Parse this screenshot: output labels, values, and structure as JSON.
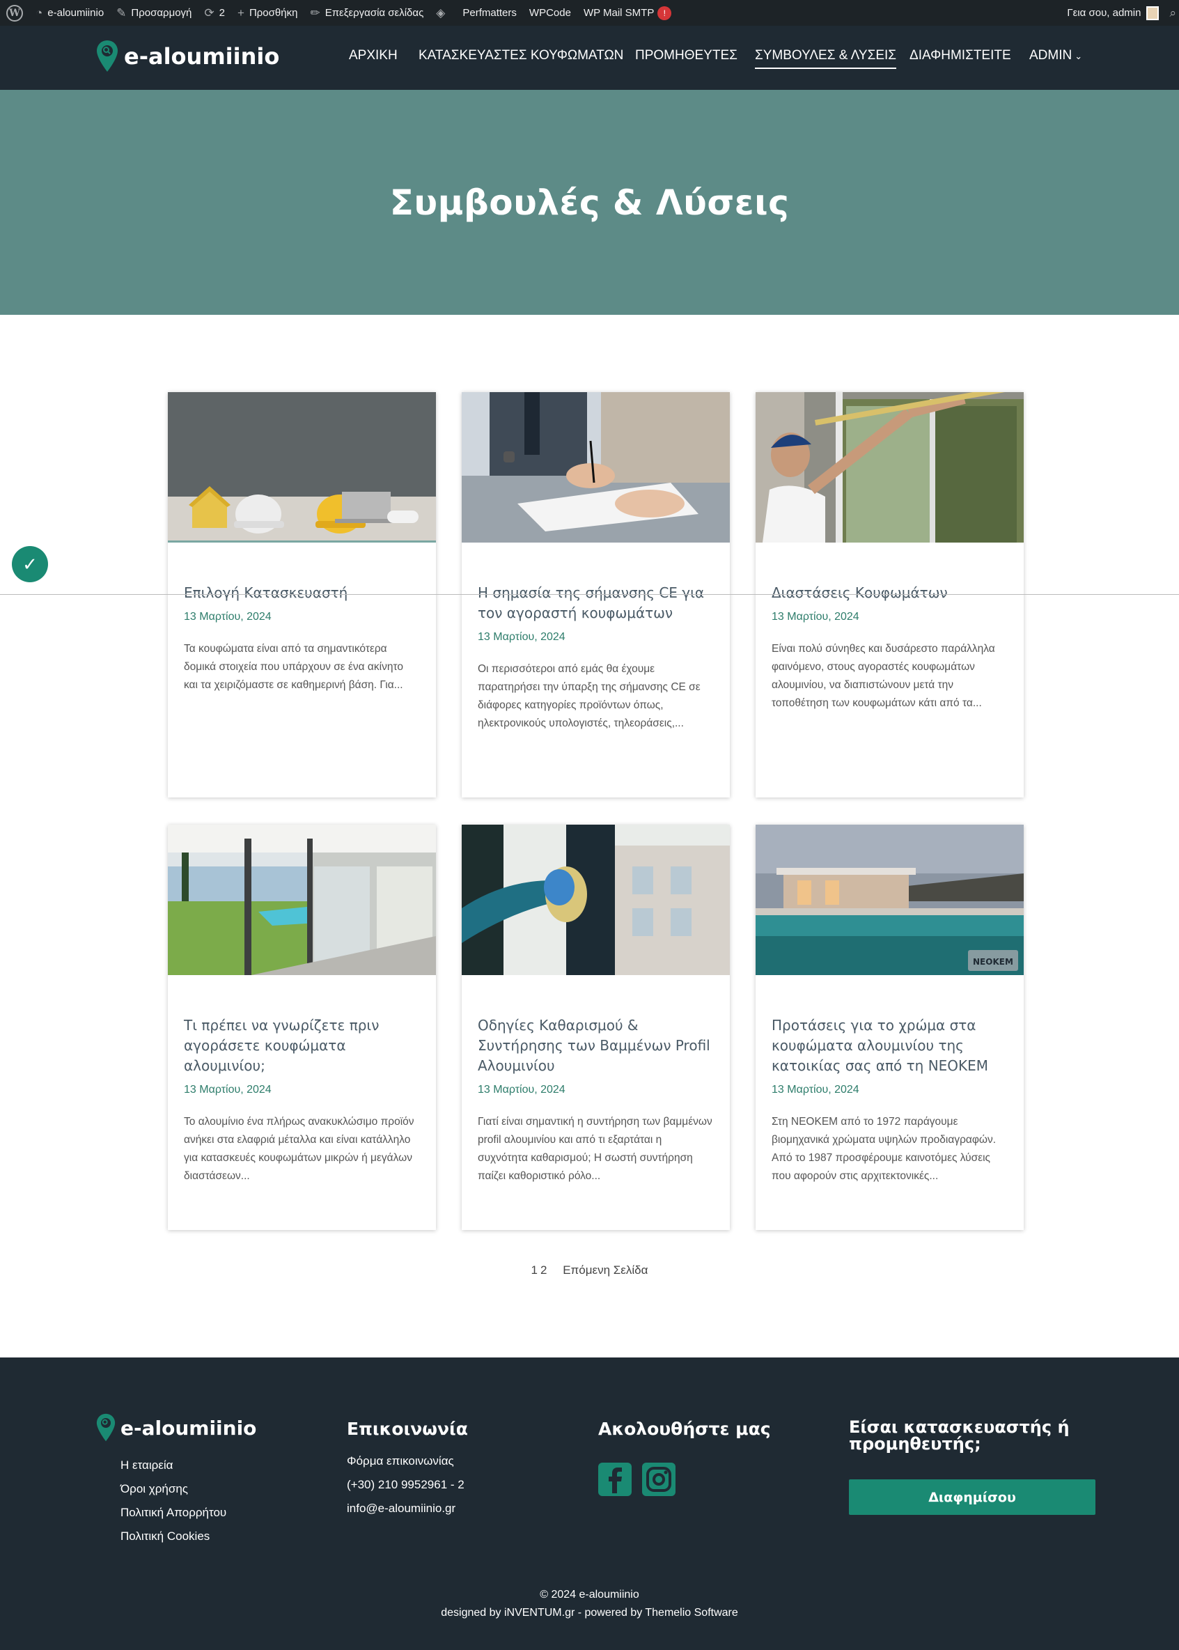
{
  "admin_bar": {
    "site": "e-aloumiinio",
    "customize": "Προσαρμογή",
    "updates": "2",
    "new": "Προσθήκη",
    "edit": "Επεξεργασία σελίδας",
    "perfmatters": "Perfmatters",
    "wpcode": "WPCode",
    "smtp": "WP Mail SMTP",
    "smtp_badge": "!",
    "greeting": "Γεια σου, admin"
  },
  "header": {
    "logo": "e-aloumiinio",
    "nav": [
      "ΑΡΧΙΚΗ",
      "ΚΑΤΑΣΚΕΥΑΣΤΕΣ ΚΟΥΦΩΜΑΤΩΝ",
      "ΠΡΟΜΗΘΕΥΤΕΣ",
      "ΣΥΜΒΟΥΛΕΣ & ΛΥΣΕΙΣ",
      "ΔΙΑΦΗΜΙΣΤΕΙΤΕ",
      "ADMIN"
    ]
  },
  "hero": {
    "title": "Συμβουλές & Λύσεις"
  },
  "posts": [
    {
      "title": "Επιλογή Κατασκευαστή",
      "date": "13 Μαρτίου, 2024",
      "excerpt": "Τα κουφώματα είναι από τα σημαντικότερα δομικά στοιχεία που υπάρχουν σε ένα ακίνητο και τα χειριζόμαστε σε καθημερινή βάση. Για..."
    },
    {
      "title": "Η σημασία της σήμανσης CE για τον αγοραστή κουφωμάτων",
      "date": "13 Μαρτίου, 2024",
      "excerpt": "Οι περισσότεροι από εμάς θα έχουμε παρατηρήσει την ύπαρξη της σήμανσης CE σε διάφορες κατηγορίες προϊόντων όπως, ηλεκτρονικούς υπολογιστές, τηλεοράσεις,..."
    },
    {
      "title": "Διαστάσεις Κουφωμάτων",
      "date": "13 Μαρτίου, 2024",
      "excerpt": "Είναι πολύ σύνηθες και δυσάρεστο παράλληλα φαινόμενο, στους αγοραστές κουφωμάτων αλουμινίου, να διαπιστώνουν μετά την τοποθέτηση των κουφωμάτων κάτι από τα..."
    },
    {
      "title": "Τι πρέπει να γνωρίζετε πριν αγοράσετε κουφώματα αλουμινίου;",
      "date": "13 Μαρτίου, 2024",
      "excerpt": "Το αλουμίνιο ένα πλήρως ανακυκλώσιμο προϊόν ανήκει στα ελαφριά μέταλλα και είναι κατάλληλο για κατασκευές κουφωμάτων μικρών ή μεγάλων διαστάσεων..."
    },
    {
      "title": "Οδηγίες Καθαρισμού & Συντήρησης των Βαμμένων Profil Αλουμινίου",
      "date": "13 Μαρτίου, 2024",
      "excerpt": "Γιατί είναι σημαντική η συντήρηση των βαμμένων profil αλουμινίου και από τι εξαρτάται η συχνότητα καθαρισμού; Η σωστή συντήρηση παίζει καθοριστικό ρόλο..."
    },
    {
      "title": "Προτάσεις για το χρώμα στα κουφώματα αλουμινίου της κατοικίας σας από τη ΝΕΟΚΕΜ",
      "date": "13 Μαρτίου, 2024",
      "excerpt": "Στη ΝΕΟΚΕΜ από το 1972 παράγουμε βιομηχανικά χρώματα υψηλών προδιαγραφών. Από το 1987 προσφέρουμε καινοτόμες λύσεις που αφορούν στις αρχιτεκτονικές..."
    }
  ],
  "image_watermark": "NEOKEM",
  "pagination": {
    "page1": "1",
    "page2": "2",
    "next": "Επόμενη Σελίδα"
  },
  "footer": {
    "logo": "e-aloumiinio",
    "company_links": [
      "Η εταιρεία",
      "Όροι χρήσης",
      "Πολιτική Απορρήτου",
      "Πολιτική Cookies"
    ],
    "contact_title": "Επικοινωνία",
    "contact_links": [
      "Φόρμα επικοινωνίας",
      "(+30) 210 9952961 - 2",
      "info@e-aloumiinio.gr"
    ],
    "follow_title": "Ακολουθήστε μας",
    "cta_title": "Είσαι κατασκευαστής ή προμηθευτής;",
    "cta_button": "Διαφημίσου",
    "copyright": "© 2024 e-aloumiinio",
    "credits": "designed by iNVENTUM.gr - powered by Themelio Software"
  },
  "colors": {
    "brand": "#1a8a73",
    "hero_bg": "#5d8b87",
    "dark_bg": "#1f2a33",
    "date_green": "#2e7d6b"
  }
}
